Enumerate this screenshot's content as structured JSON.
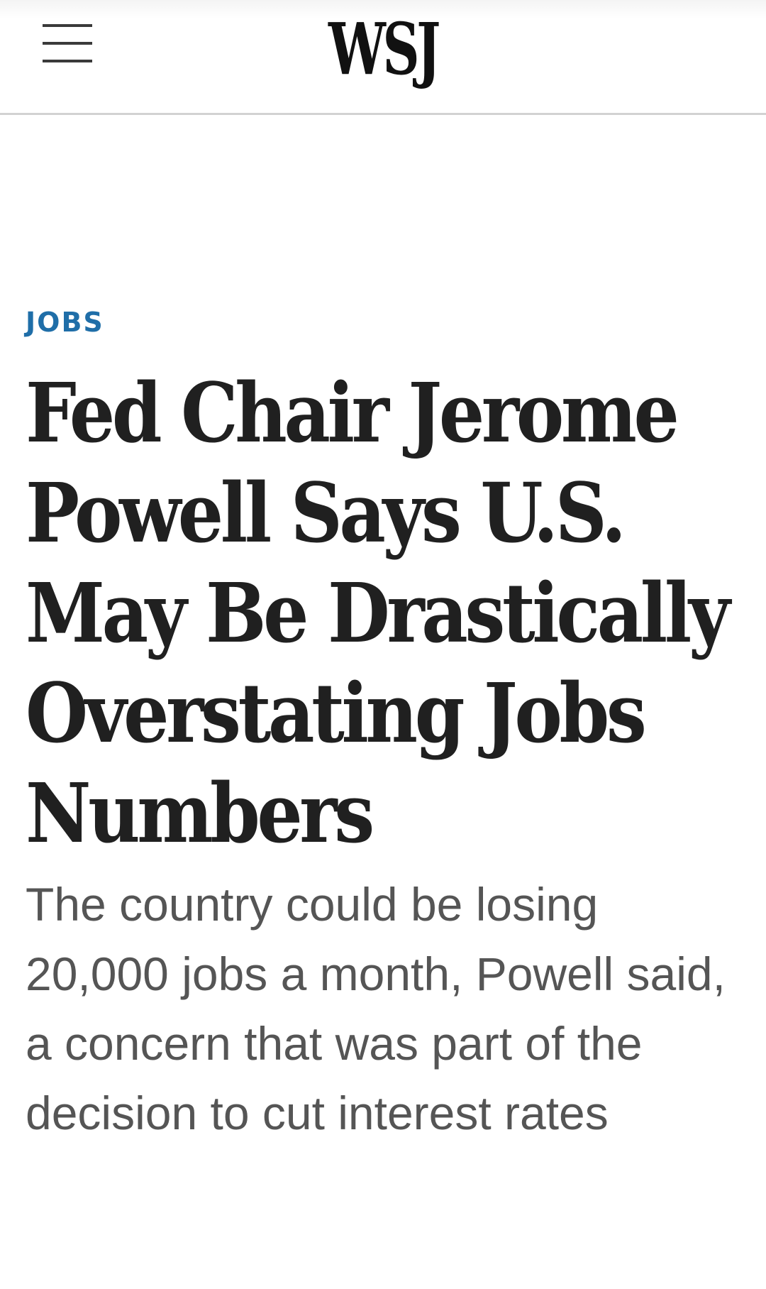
{
  "header": {
    "menu_icon": "hamburger-menu-icon",
    "logo_text": "WSJ"
  },
  "article": {
    "category": "JOBS",
    "headline": "Fed Chair Jerome Powell Says U.S. May Be Drastically Overstating Jobs Numbers",
    "dek": "The country could be losing 20,000 jobs a month, Powell said, a concern that was part of the decision to cut interest rates"
  },
  "colors": {
    "category": "#1f6ea8",
    "headline": "#202020",
    "dek": "#555555",
    "header_border": "#d2d2d2"
  }
}
